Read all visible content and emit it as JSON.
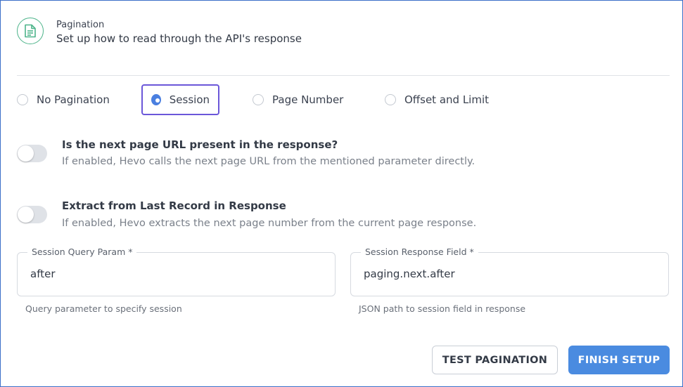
{
  "header": {
    "icon": "document-icon",
    "label": "Pagination",
    "subtitle": "Set up how to read through the API's response"
  },
  "pagination_options": [
    {
      "label": "No Pagination",
      "selected": false
    },
    {
      "label": "Session",
      "selected": true
    },
    {
      "label": "Page Number",
      "selected": false
    },
    {
      "label": "Offset and Limit",
      "selected": false
    }
  ],
  "settings": [
    {
      "title": "Is the next page URL present in the response?",
      "description": "If enabled, Hevo calls the next page URL from the mentioned parameter directly.",
      "enabled": false
    },
    {
      "title": "Extract from Last Record in Response",
      "description": "If enabled, Hevo extracts the next page number from the current page response.",
      "enabled": false
    }
  ],
  "fields": {
    "query_param": {
      "label": "Session Query Param *",
      "value": "after",
      "hint": "Query parameter to specify session"
    },
    "response_field": {
      "label": "Session Response Field *",
      "value": "paging.next.after",
      "hint": "JSON path to session field in response"
    }
  },
  "buttons": {
    "test": "TEST PAGINATION",
    "finish": "FINISH SETUP"
  },
  "colors": {
    "accent": "#4a8be0",
    "selected_border": "#6b57d9",
    "icon_green": "#4db48a"
  }
}
